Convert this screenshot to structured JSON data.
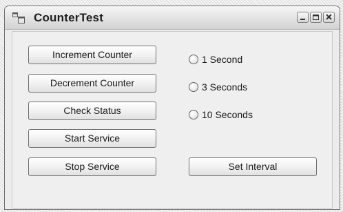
{
  "window": {
    "title": "CounterTest",
    "controls": [
      "minimize-icon",
      "maximize-icon",
      "close-icon"
    ]
  },
  "buttons": {
    "increment": "Increment Counter",
    "decrement": "Decrement Counter",
    "check_status": "Check Status",
    "start_service": "Start Service",
    "stop_service": "Stop Service",
    "set_interval": "Set Interval"
  },
  "interval_options": [
    {
      "label": "1 Second",
      "selected": false
    },
    {
      "label": "3 Seconds",
      "selected": false
    },
    {
      "label": "10 Seconds",
      "selected": false
    }
  ]
}
